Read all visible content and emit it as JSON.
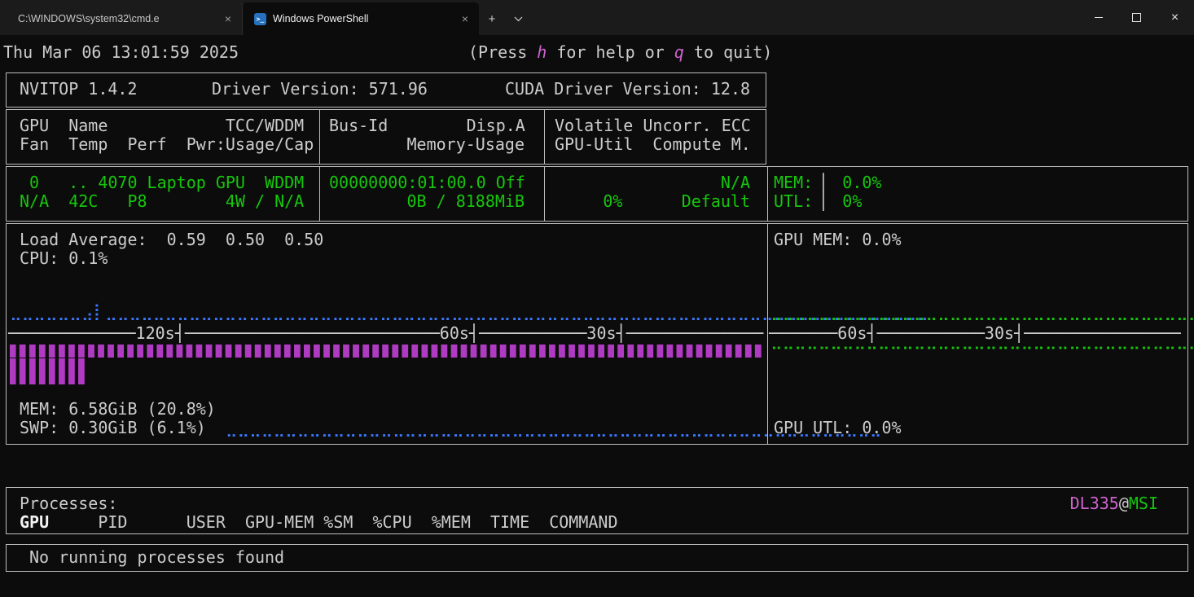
{
  "colors": {
    "terminal_bg": "#0c0c0c",
    "tabbar_bg": "#1b1b1b",
    "foreground": "#cccccc",
    "border": "#bdbdbd",
    "green": "#16c60c",
    "magenta": "#cf63cf",
    "graph_magenta": "#b03bc3",
    "blue": "#3b78ff",
    "powershell_icon_blue": "#2671be"
  },
  "window": {
    "tabs": [
      {
        "label": "C:\\WINDOWS\\system32\\cmd.e",
        "close_glyph": "×"
      },
      {
        "label": "Windows PowerShell",
        "close_glyph": "×"
      }
    ],
    "powershell_icon_glyph": ">_",
    "new_tab_glyph": "+",
    "close_glyph": "×"
  },
  "terminal": {
    "datetime": "Thu Mar 06 13:01:59 2025",
    "help": {
      "pre": "(Press ",
      "key_help": "h",
      "mid": " for help or ",
      "key_quit": "q",
      "post": " to quit)"
    },
    "info_bar": {
      "app_version": "NVITOP 1.4.2",
      "driver_version": "Driver Version: 571.96",
      "cuda_version": "CUDA Driver Version: 12.8"
    },
    "gpu_header": {
      "col1_line1": "GPU  Name            TCC/WDDM",
      "col1_line2": "Fan  Temp  Perf  Pwr:Usage/Cap",
      "col2_line1": "Bus-Id        Disp.A",
      "col2_line2": "Memory-Usage",
      "col3_line1": "Volatile Uncorr. ECC",
      "col3_line2": "GPU-Util  Compute M."
    },
    "gpu_row": {
      "col1_line1": " 0   .. 4070 Laptop GPU  WDDM",
      "col1_line2": "N/A  42C   P8        4W / N/A",
      "col2_line1": "00000000:01:00.0 Off",
      "col2_line2": "0B / 8188MiB",
      "col3_line1": "N/A",
      "col3_line2": "0%      Default",
      "mem_label": "MEM: ",
      "mem_gauge": "▏",
      "mem_value": " 0.0%",
      "utl_label": "UTL: ",
      "utl_gauge": "▏",
      "utl_value": " 0%"
    },
    "monitor": {
      "load_average": "Load Average:  0.59  0.50  0.50",
      "cpu": "CPU: 0.1%",
      "mem": "MEM: 6.58GiB (20.8%)",
      "swp": "SWP: 0.30GiB (6.1%)",
      "gpu_mem": "GPU MEM: 0.0%",
      "gpu_utl": "GPU UTL: 0.0%",
      "axis_left": [
        {
          "t": "─",
          "r": 13
        },
        {
          "t": "120s┤"
        },
        {
          "t": "─",
          "r": 26
        },
        {
          "t": "60s┤"
        },
        {
          "t": "─",
          "r": 11
        },
        {
          "t": "30s┤"
        },
        {
          "t": "─",
          "r": 14
        }
      ],
      "axis_right": [
        {
          "t": "─",
          "r": 7
        },
        {
          "t": "60s┤"
        },
        {
          "t": "─",
          "r": 11
        },
        {
          "t": "30s┤"
        },
        {
          "t": "─",
          "r": 16
        }
      ],
      "cpu_graph": [
        {
          "t": "⣀",
          "r": 6
        },
        {
          "t": "⣠⡇"
        },
        {
          "t": "⣀",
          "r": 69
        }
      ],
      "swp_graph": [
        {
          "t": "  "
        },
        {
          "t": "⣀",
          "r": 55
        }
      ],
      "mem_row_1": [
        {
          "t": "▋",
          "r": 77
        }
      ],
      "mem_row_2": [
        {
          "t": "▋",
          "r": 8
        }
      ],
      "mem_row_3": [
        {
          "t": "▋",
          "r": 8
        }
      ],
      "gpu_mem_graph": [
        {
          "t": "⣀",
          "r": 42
        }
      ],
      "gpu_utl_graph": [
        {
          "t": "⠉",
          "r": 42
        }
      ]
    },
    "processes": {
      "title": "Processes:",
      "host_user": "DL335",
      "host_at": "@",
      "host_machine": "MSI",
      "header_gpu": "GPU",
      "header_rest": "     PID      USER  GPU-MEM %SM  %CPU  %MEM  TIME  COMMAND",
      "empty_message": "No running processes found"
    }
  }
}
